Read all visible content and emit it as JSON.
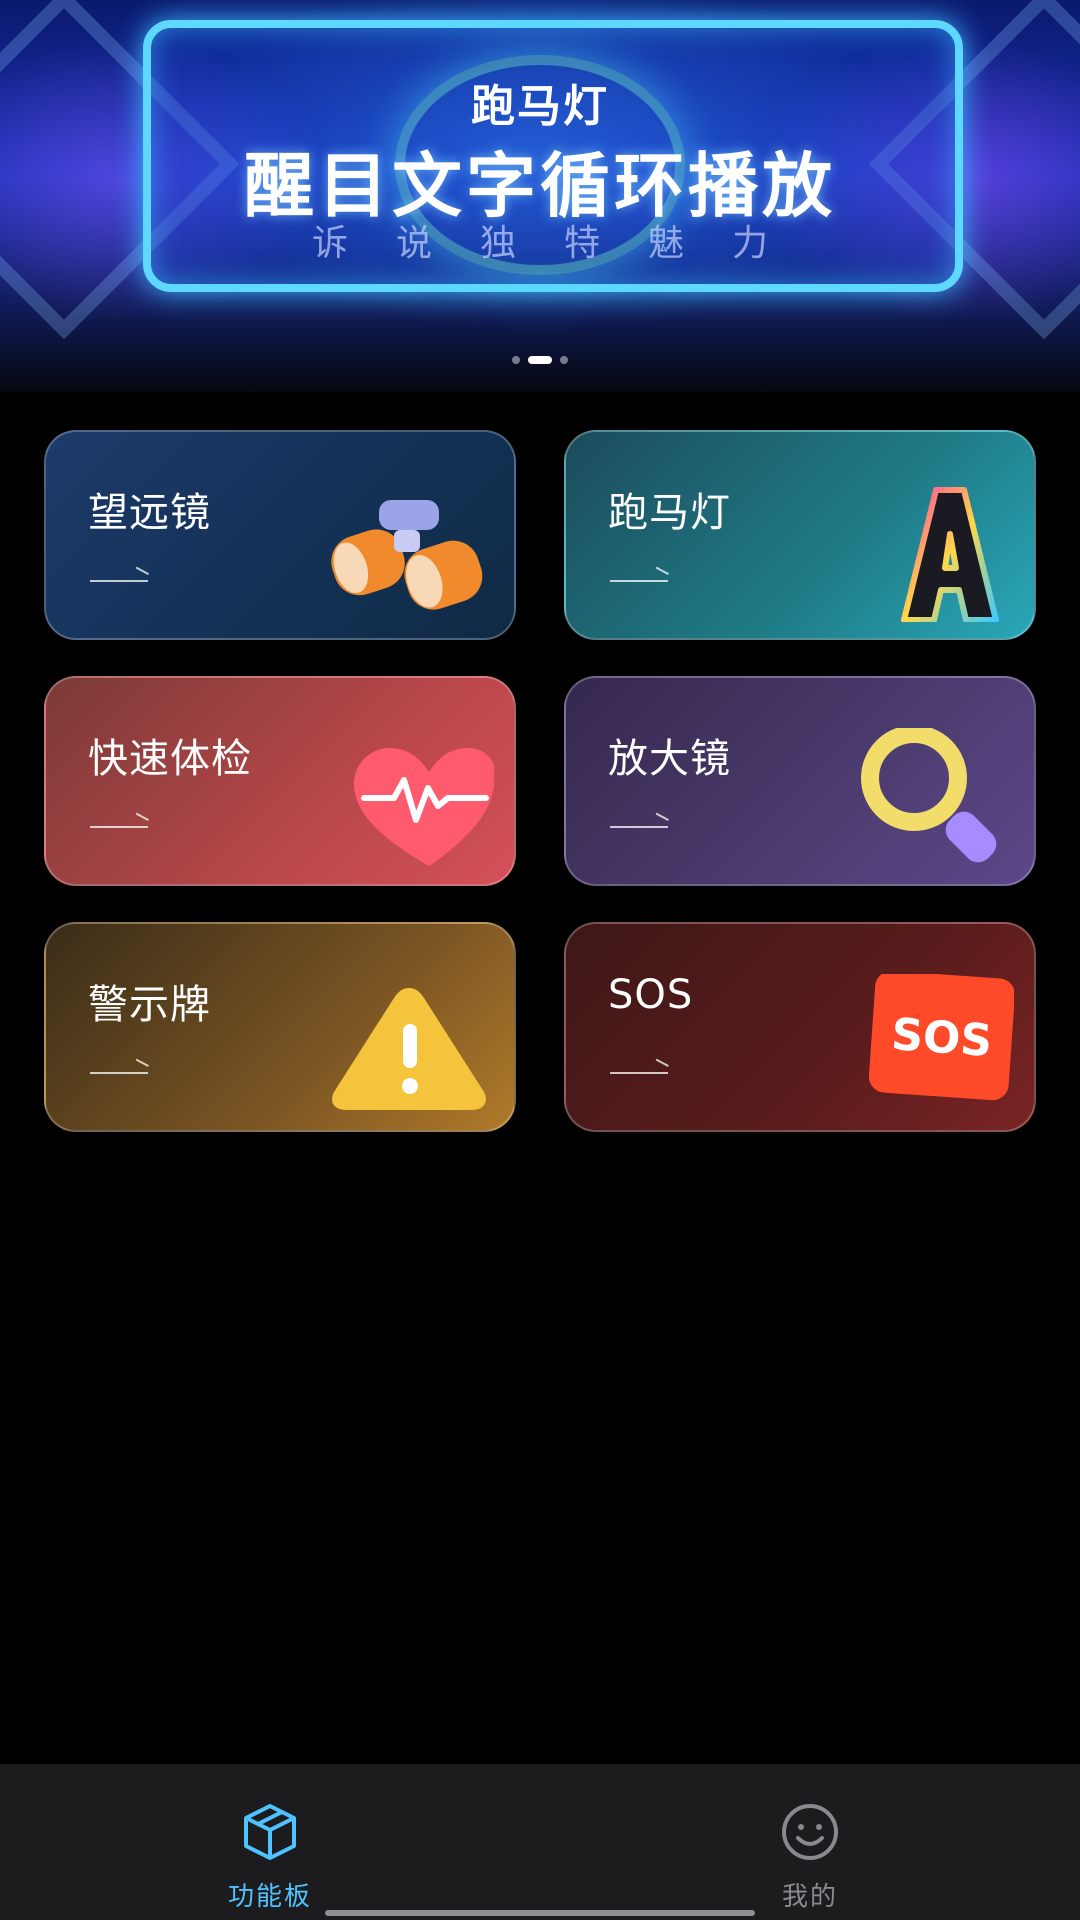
{
  "banner": {
    "tag": "跑马灯",
    "headline": "醒目文字循环播放",
    "subline": "诉说独特魅力",
    "page_count": 3,
    "active_page": 2
  },
  "features": [
    {
      "label": "望远镜",
      "icon": "binoculars-icon"
    },
    {
      "label": "跑马灯",
      "icon": "neon-letter-a-icon"
    },
    {
      "label": "快速体检",
      "icon": "heart-pulse-icon"
    },
    {
      "label": "放大镜",
      "icon": "magnifier-icon"
    },
    {
      "label": "警示牌",
      "icon": "warning-sign-icon"
    },
    {
      "label": "SOS",
      "icon": "sos-sign-icon"
    }
  ],
  "sos_icon_text": "SOS",
  "nav": {
    "home_label": "功能板",
    "mine_label": "我的",
    "active": "home",
    "active_color": "#4fc3ff",
    "inactive_color": "#8a8a8e"
  }
}
